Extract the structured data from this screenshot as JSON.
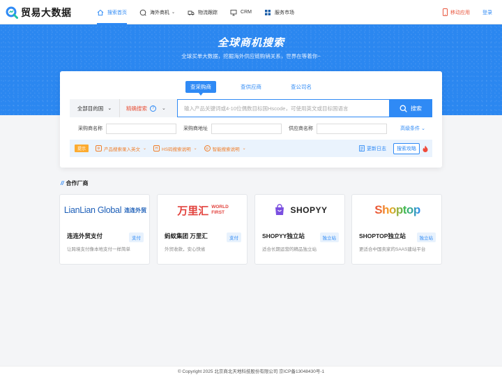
{
  "brand": {
    "name": "贸易大数据",
    "color": "#2f8af5"
  },
  "nav": [
    {
      "label": "搜索首页",
      "icon": "home-icon",
      "active": true
    },
    {
      "label": "海外商机",
      "icon": "globe-icon",
      "dropdown": true
    },
    {
      "label": "物流跟踪",
      "icon": "truck-icon"
    },
    {
      "label": "CRM",
      "icon": "monitor-icon"
    },
    {
      "label": "服务市场",
      "icon": "grid-icon"
    }
  ],
  "header_right": {
    "mobile": "移动应用",
    "login": "登录"
  },
  "hero": {
    "title": "全球商机搜索",
    "subtitle": "全球买单大数据，挖掘海外供应链购销关系，世界在等着你~"
  },
  "search": {
    "tabs": [
      "查采购商",
      "查供应商",
      "查公司名"
    ],
    "active_tab": 0,
    "destination": "全部目的国",
    "mode": "精确搜索",
    "placeholder": "输入产品关键词或4-10位偶数目标国Hscode，可使用英文或目标国语言",
    "button": "搜索"
  },
  "filters": {
    "buyer_name": "采购商名称",
    "buyer_address": "采购商地址",
    "supplier_name": "供应商名称",
    "advanced": "高级条件"
  },
  "tips": {
    "badge": "提示",
    "items": [
      "产品搜索录入英文",
      "HS码搜索说明",
      "智能搜索说明"
    ],
    "changelog": "更新日志",
    "strategy": "搜索攻略"
  },
  "partners_title": "合作厂商",
  "partners": [
    {
      "logo_text": "LianLian Global",
      "logo_cn": "连连外贸",
      "name": "连连外贸支付",
      "tag": "支付",
      "desc": "让跨境支付像本地支付一样简单"
    },
    {
      "logo_text": "万里汇",
      "logo_en1": "WORLD",
      "logo_en2": "FIRST",
      "name": "蚂蚁集团 万里汇",
      "tag": "支付",
      "desc": "外贸收款，安心快省"
    },
    {
      "logo_text": "SHOPYY",
      "name": "SHOPYY独立站",
      "tag": "独立站",
      "desc": "适合长期运营的精品独立站"
    },
    {
      "logo_text": "Shoptop",
      "name": "SHOPTOP独立站",
      "tag": "独立站",
      "desc": "更适合中国卖家的SAAS建站平台"
    }
  ],
  "footer": "© Copyright 2025 北京商北天地科技股份有限公司 京ICP备13048430号-1"
}
